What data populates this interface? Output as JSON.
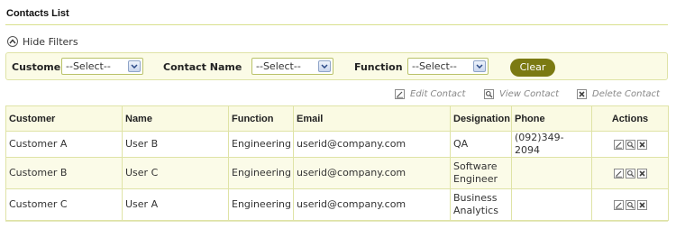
{
  "page": {
    "title": "Contacts List"
  },
  "filters": {
    "toggle_label": "Hide Filters",
    "customer_label": "Customer",
    "customer_value": "--Select--",
    "contact_name_label": "Contact Name",
    "contact_name_value": "--Select--",
    "function_label": "Function",
    "function_value": "--Select--",
    "clear_label": "Clear"
  },
  "legend": {
    "edit": "Edit Contact",
    "view": "View Contact",
    "delete": "Delete Contact"
  },
  "table": {
    "columns": [
      "Customer",
      "Name",
      "Function",
      "Email",
      "Designation",
      "Phone",
      "Actions"
    ],
    "rows": [
      {
        "customer": "Customer A",
        "name": "User B",
        "function": "Engineering",
        "email": "userid@company.com",
        "designation": "QA",
        "phone": "(092)349-2094"
      },
      {
        "customer": "Customer B",
        "name": "User C",
        "function": "Engineering",
        "email": "userid@company.com",
        "designation": "Software Engineer",
        "phone": ""
      },
      {
        "customer": "Customer C",
        "name": "User A",
        "function": "Engineering",
        "email": "userid@company.com",
        "designation": "Business Analytics",
        "phone": ""
      }
    ]
  },
  "icons": {
    "toggle": "chevron-up-circle-icon",
    "select_arrow": "chevron-down-icon",
    "edit": "pencil-icon",
    "view": "magnifier-icon",
    "delete": "close-icon"
  },
  "colors": {
    "accent": "#7b7a12",
    "border": "#dfe3a6",
    "panel": "#fbfbe6"
  }
}
